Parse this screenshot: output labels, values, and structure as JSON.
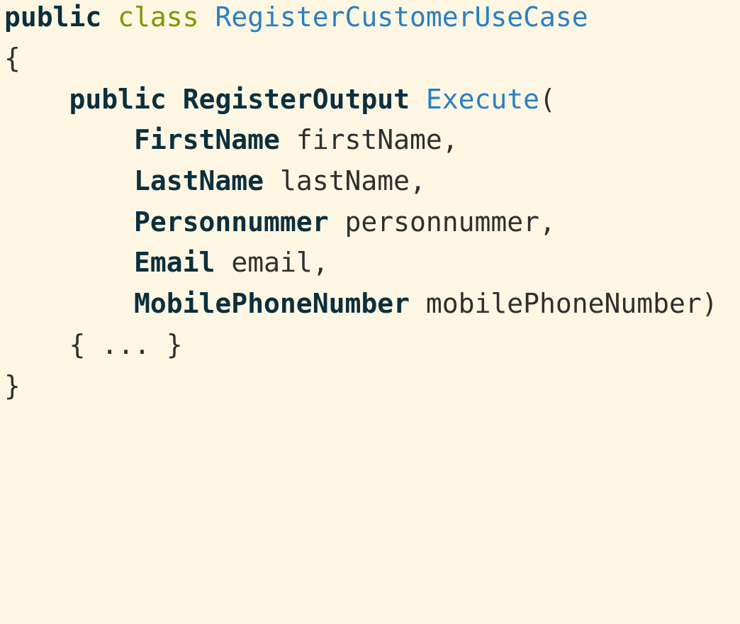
{
  "code": {
    "lines": [
      {
        "indent": "",
        "tokens": [
          {
            "text": "public",
            "role": "keyword"
          },
          {
            "text": " ",
            "role": "space"
          },
          {
            "text": "class",
            "role": "keyword-class"
          },
          {
            "text": " ",
            "role": "space"
          },
          {
            "text": "RegisterCustomerUseCase",
            "role": "type-name"
          }
        ]
      },
      {
        "indent": "",
        "tokens": [
          {
            "text": "{",
            "role": "punct"
          }
        ]
      },
      {
        "indent": "    ",
        "tokens": [
          {
            "text": "public",
            "role": "keyword"
          },
          {
            "text": " ",
            "role": "space"
          },
          {
            "text": "RegisterOutput",
            "role": "type"
          },
          {
            "text": " ",
            "role": "space"
          },
          {
            "text": "Execute",
            "role": "type-name"
          },
          {
            "text": "(",
            "role": "punct"
          }
        ]
      },
      {
        "indent": "        ",
        "tokens": [
          {
            "text": "FirstName",
            "role": "type"
          },
          {
            "text": " ",
            "role": "space"
          },
          {
            "text": "firstName",
            "role": "param"
          },
          {
            "text": ",",
            "role": "punct"
          }
        ]
      },
      {
        "indent": "        ",
        "tokens": [
          {
            "text": "LastName",
            "role": "type"
          },
          {
            "text": " ",
            "role": "space"
          },
          {
            "text": "lastName",
            "role": "param"
          },
          {
            "text": ",",
            "role": "punct"
          }
        ]
      },
      {
        "indent": "        ",
        "tokens": [
          {
            "text": "Personnummer",
            "role": "type"
          },
          {
            "text": " ",
            "role": "space"
          },
          {
            "text": "personnummer",
            "role": "param"
          },
          {
            "text": ",",
            "role": "punct"
          }
        ]
      },
      {
        "indent": "        ",
        "tokens": [
          {
            "text": "Email",
            "role": "type"
          },
          {
            "text": " ",
            "role": "space"
          },
          {
            "text": "email",
            "role": "param"
          },
          {
            "text": ",",
            "role": "punct"
          }
        ]
      },
      {
        "indent": "        ",
        "tokens": [
          {
            "text": "MobilePhoneNumber",
            "role": "type"
          },
          {
            "text": " ",
            "role": "space"
          },
          {
            "text": "mobilePhoneNumber",
            "role": "param"
          },
          {
            "text": ")",
            "role": "punct"
          }
        ]
      },
      {
        "indent": "    ",
        "tokens": [
          {
            "text": "{ ... }",
            "role": "punct"
          }
        ]
      },
      {
        "indent": "",
        "tokens": [
          {
            "text": "}",
            "role": "punct"
          }
        ]
      }
    ]
  },
  "colors": {
    "background": "#fdf6e3",
    "keyword": "#0b2f3d",
    "keyword_class": "#7a9a00",
    "type_name": "#2a7fc2",
    "text": "#2f2f2f"
  }
}
